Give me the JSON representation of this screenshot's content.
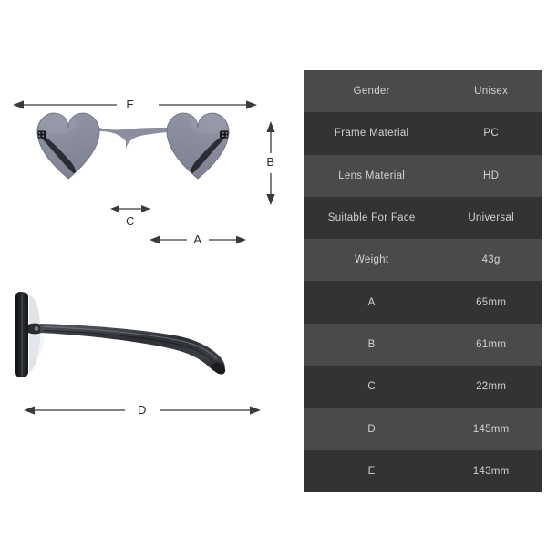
{
  "product": {
    "type": "heart-shaped rimless sunglasses",
    "views": [
      {
        "name": "front-view",
        "label": "front view"
      },
      {
        "name": "side-view",
        "label": "side view"
      }
    ]
  },
  "diagram": {
    "measurement_labels": {
      "a": "A",
      "b": "B",
      "c": "C",
      "d": "D",
      "e": "E"
    },
    "colors": {
      "lens": "#8b8fa0",
      "lens_dark": "#7e8291",
      "frame_dark": "#1f2126",
      "temple": "#2b2d33",
      "arrow": "#3a3a3a",
      "label_text": "#2d2d2d",
      "background": "#ffffff"
    }
  },
  "spec_table": {
    "colors": {
      "row_light": "#4a4a4a",
      "row_dark": "#333333",
      "text": "#d2d2d2"
    },
    "rows": [
      {
        "key": "Gender",
        "value": "Unisex"
      },
      {
        "key": "Frame Material",
        "value": "PC"
      },
      {
        "key": "Lens Material",
        "value": "HD"
      },
      {
        "key": "Suitable For Face",
        "value": "Universal"
      },
      {
        "key": "Weight",
        "value": "43g"
      },
      {
        "key": "A",
        "value": "65mm"
      },
      {
        "key": "B",
        "value": "61mm"
      },
      {
        "key": "C",
        "value": "22mm"
      },
      {
        "key": "D",
        "value": "145mm"
      },
      {
        "key": "E",
        "value": "143mm"
      }
    ]
  }
}
